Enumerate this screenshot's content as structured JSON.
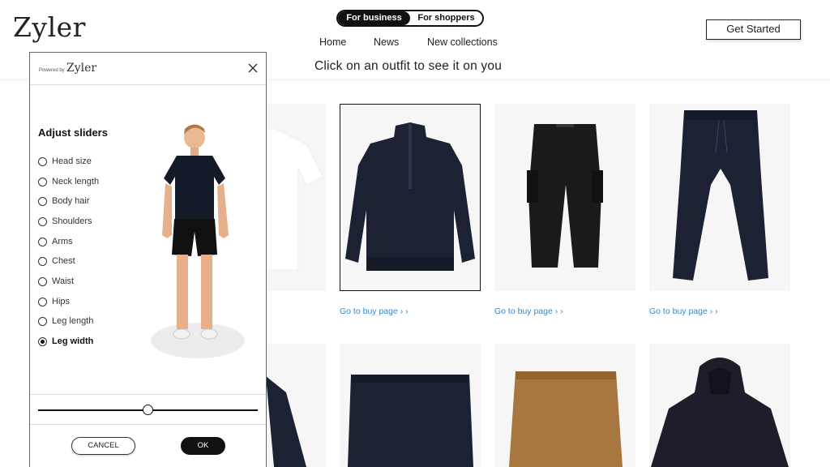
{
  "header": {
    "logo": "Zyler",
    "toggle": {
      "business": "For business",
      "shoppers": "For shoppers"
    },
    "nav": {
      "home": "Home",
      "news": "News",
      "collections": "New collections"
    },
    "tagline": "Click on an outfit to see it on you",
    "cta": "Get Started"
  },
  "products": {
    "buy_link": "Go to buy page",
    "buy_arrows": "› ›"
  },
  "panel": {
    "powered_by": "Powered by",
    "powered_logo": "Zyler",
    "title": "Adjust sliders",
    "options": [
      "Head size",
      "Neck length",
      "Body hair",
      "Shoulders",
      "Arms",
      "Chest",
      "Waist",
      "Hips",
      "Leg length",
      "Leg width"
    ],
    "selected_option": "Leg width",
    "slider_value": 0.5,
    "cancel": "CANCEL",
    "ok": "OK"
  },
  "colors": {
    "link": "#3a86c8",
    "dark": "#111111",
    "garment_navy": "#1c2233",
    "garment_black": "#1a1a1a",
    "garment_tan": "#a8773f"
  }
}
